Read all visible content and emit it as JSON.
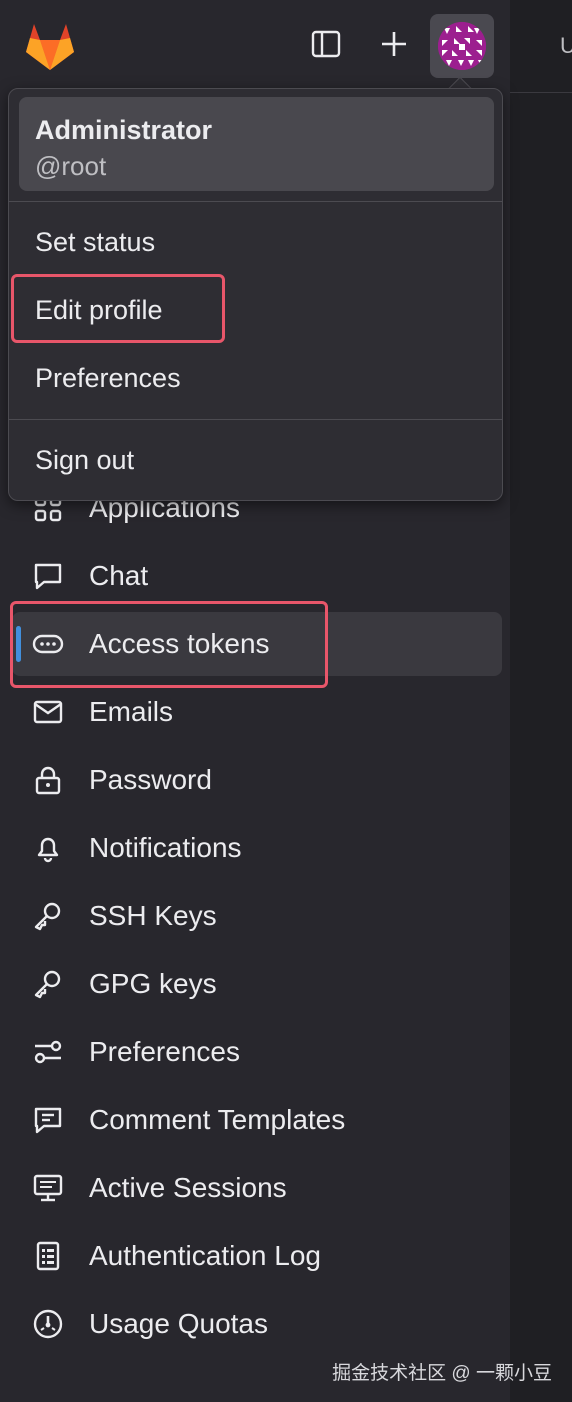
{
  "topbar": {
    "logo_icon": "gitlab-tanuki-icon",
    "sidebar_toggle_icon": "sidebar-toggle-icon",
    "new_icon": "plus-icon",
    "avatar_icon": "user-avatar"
  },
  "main": {
    "peek_text": "U"
  },
  "user_menu": {
    "name": "Administrator",
    "username": "@root",
    "items": [
      {
        "label": "Set status"
      },
      {
        "label": "Edit profile"
      },
      {
        "label": "Preferences"
      }
    ],
    "sign_out": "Sign out"
  },
  "sidebar": {
    "items": [
      {
        "label": "Applications",
        "icon": "applications-icon"
      },
      {
        "label": "Chat",
        "icon": "chat-icon"
      },
      {
        "label": "Access tokens",
        "icon": "token-icon",
        "active": true
      },
      {
        "label": "Emails",
        "icon": "mail-icon"
      },
      {
        "label": "Password",
        "icon": "lock-icon"
      },
      {
        "label": "Notifications",
        "icon": "bell-icon"
      },
      {
        "label": "SSH Keys",
        "icon": "key-icon"
      },
      {
        "label": "GPG keys",
        "icon": "key-icon"
      },
      {
        "label": "Preferences",
        "icon": "preferences-icon"
      },
      {
        "label": "Comment Templates",
        "icon": "comment-template-icon"
      },
      {
        "label": "Active Sessions",
        "icon": "monitor-icon"
      },
      {
        "label": "Authentication Log",
        "icon": "log-icon"
      },
      {
        "label": "Usage Quotas",
        "icon": "quota-icon"
      }
    ]
  },
  "colors": {
    "sidebar_bg": "#28272d",
    "active_indicator": "#428fdc",
    "highlight": "#e8566a",
    "avatar": "#9c1f8f"
  },
  "watermark": "掘金技术社区 @ 一颗小豆"
}
